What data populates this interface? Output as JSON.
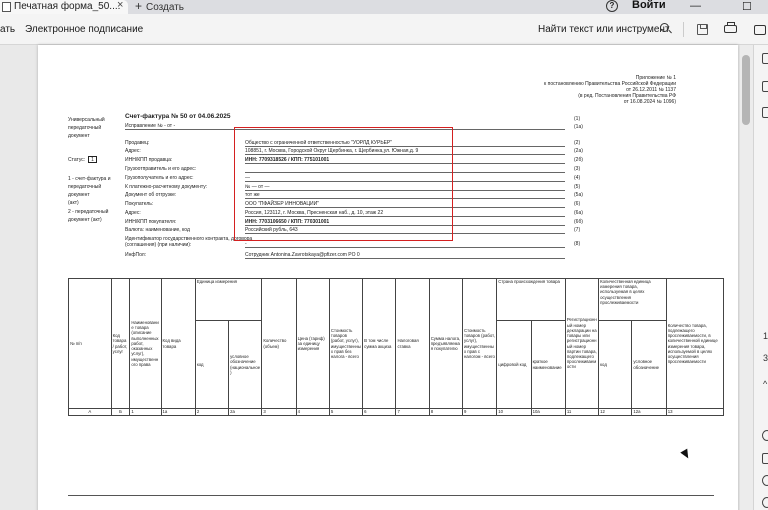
{
  "browser": {
    "tab_title": "Печатная форма_50....",
    "tab_close": "×",
    "new_tab_plus": "+",
    "new_tab_label": "Создать",
    "help_glyph": "?",
    "login_label": "Войти",
    "minimize_glyph": "—",
    "maximize_glyph": "☐"
  },
  "toolbar": {
    "edge_label": "ать",
    "signature_label": "Электронное подписание",
    "find_label": "Найти текст или инструмент"
  },
  "rail": {
    "page_number": "1",
    "page_total": "3",
    "chevron": "^"
  },
  "doc": {
    "annex": [
      "Приложение № 1",
      "к постановлению Правительства Российской Федерации",
      "от 26.12.2011 № 1137",
      "(в ред. Постановления Правительства РФ",
      "от 16.08.2024 № 1096)"
    ],
    "left_block": [
      "Универсальный",
      "передаточный",
      "документ"
    ],
    "status_label": "Статус:",
    "status_value": "1",
    "status_notes": [
      "1 - счет-фактура и",
      "передаточный",
      "документ",
      "(акт)",
      "2 - передаточный",
      "документ (акт)"
    ],
    "invoice_title": "Счет-фактура № 50  от 04.06.2025",
    "correction": "Исправление № - от -",
    "seller_label": "Продавец:",
    "seller_value": "Общество с ограниченной ответственностью \"УОРЛД КУРЬЕР\"",
    "address_label": "Адрес:",
    "seller_address": "108851, г. Москва, Городской Округ Щербинка, г. Щербинка,ул. Южная,д. 9",
    "seller_inn_label": "ИНН/КПП продавца:",
    "seller_inn": "ИНН: 7709318526  /  КПП: 775101001",
    "shipper_label": "Грузоотправитель и его адрес:",
    "consignee_label": "Грузополучатель и его адрес:",
    "consignee_value": "—",
    "payment_doc_label": "К платежно-расчетному документу:",
    "payment_doc_value": "№   — от  —",
    "shipment_doc_label": "Документ об отгрузке:",
    "shipment_doc_value": "тот же",
    "buyer_label": "Покупатель:",
    "buyer_value": "ООО \"ПФАЙЗЕР ИННОВАЦИИ\"",
    "buyer_address_label": "Адрес:",
    "buyer_address": "Россия, 123112, г. Москва, Пресненская наб., д. 10, этаж 22",
    "buyer_inn_label": "ИНН/КПП покупателя:",
    "buyer_inn": "ИНН: 7703106650  /  КПП: 770301001",
    "currency_label": "Валюта: наименование, код",
    "currency_value": "Российский рубль,  643",
    "contract_label": "Идентификатор государственного контракта, договора (соглашения) (при наличии):",
    "contract_value": "-",
    "inf_label": "ИнфПол:",
    "inf_value": "Сотрудник Antonina.Zavrotskaya@pfizer.com PO 0",
    "row_codes": [
      "(1)",
      "(1а)",
      "(2)",
      "(2а)",
      "(2б)",
      "(3)",
      "(4)",
      "(5)",
      "(5а)",
      "(6)",
      "(6а)",
      "(6б)",
      "(7)",
      "(8)"
    ],
    "table_headers": {
      "num": "№ п/п",
      "code": "Код товара / работ, услуг",
      "name": "Наименование товара (описание выполненных работ, оказанных услуг), имущественного права",
      "kind": "Код вида товара",
      "unit_group": "Единица измерения",
      "unit_code": "код",
      "unit_name": "условное обозначение (национальное)",
      "qty": "Количество (объем)",
      "price": "Цена (тариф) за единицу измерения",
      "cost_wo_tax": "Стоимость товаров (работ, услуг), имущественных прав без налога - всего",
      "excise": "В том числе сумма акциза",
      "rate": "Налоговая ставка",
      "tax_sum": "Сумма налога, предъявляемая покупателю",
      "cost_with_tax": "Стоимость товаров (работ, услуг), имущественных прав с налогом - всего",
      "country_group": "Страна происхождения товара",
      "country_code": "цифровой код",
      "country_name": "краткое наименование",
      "customs": "Регистрационный номер декларации на товары или регистрационный номер партии товара, подлежащего прослеживаемости",
      "trace_unit_group": "Количественная единица измерения товара, используемая в целях осуществления прослеживаемости",
      "trace_code": "код",
      "trace_name": "условное обозначение",
      "trace_qty": "Количество товара, подлежащего прослеживаемости, в количественной единице измерения товара, используемой в целях осуществления прослеживаемости"
    },
    "column_numbers": [
      "А",
      "Б",
      "1",
      "1а",
      "2",
      "2а",
      "3",
      "4",
      "5",
      "6",
      "7",
      "8",
      "9",
      "10",
      "10а",
      "11",
      "12",
      "12а",
      "13"
    ]
  }
}
